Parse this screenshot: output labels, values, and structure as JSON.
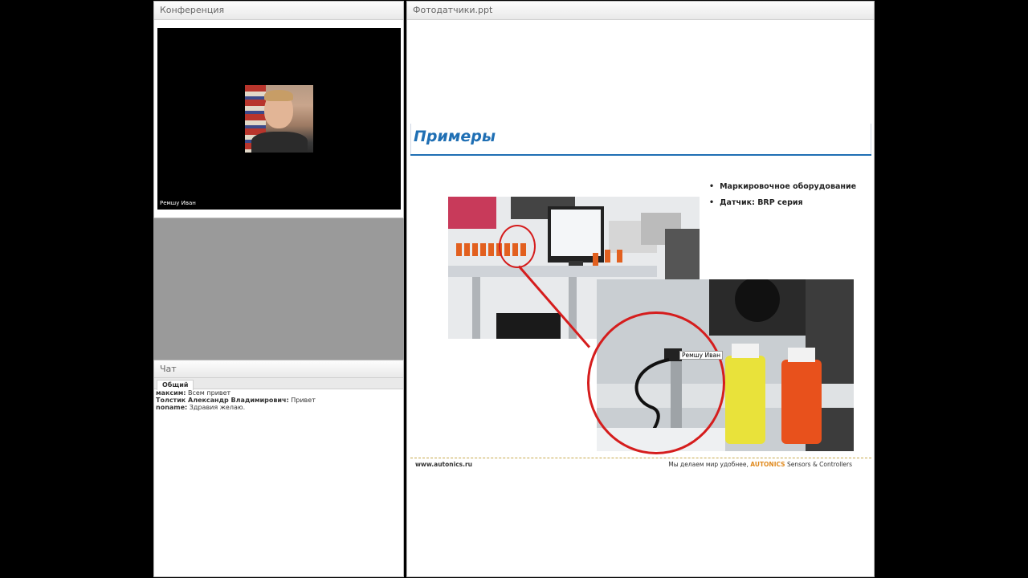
{
  "conference": {
    "title": "Конференция",
    "video_name": "Ремшу Иван"
  },
  "chat": {
    "title": "Чат",
    "tab": "Общий",
    "messages": [
      {
        "author": "максим:",
        "text": "Всем привет"
      },
      {
        "author": "Толстик Александр  Владимирович:",
        "text": "Привет"
      },
      {
        "author": "noname:",
        "text": "Здравия желаю."
      }
    ]
  },
  "presentation": {
    "title": "Фотодатчики.ppt",
    "slide": {
      "heading": "Примеры",
      "bullets": [
        "Маркировочное  оборудование",
        "Датчик:  BRP серия"
      ],
      "cursor_label": "Ремшу Иван",
      "footer_left": "www.autonics.ru",
      "footer_right_prefix": "Мы делаем мир удобнее,",
      "footer_brand": "AUTONICS",
      "footer_right_suffix": "Sensors & Controllers"
    }
  },
  "colors": {
    "heading": "#1f6fb4",
    "accent_red": "#d51d1d",
    "brand": "#e08a1e"
  }
}
